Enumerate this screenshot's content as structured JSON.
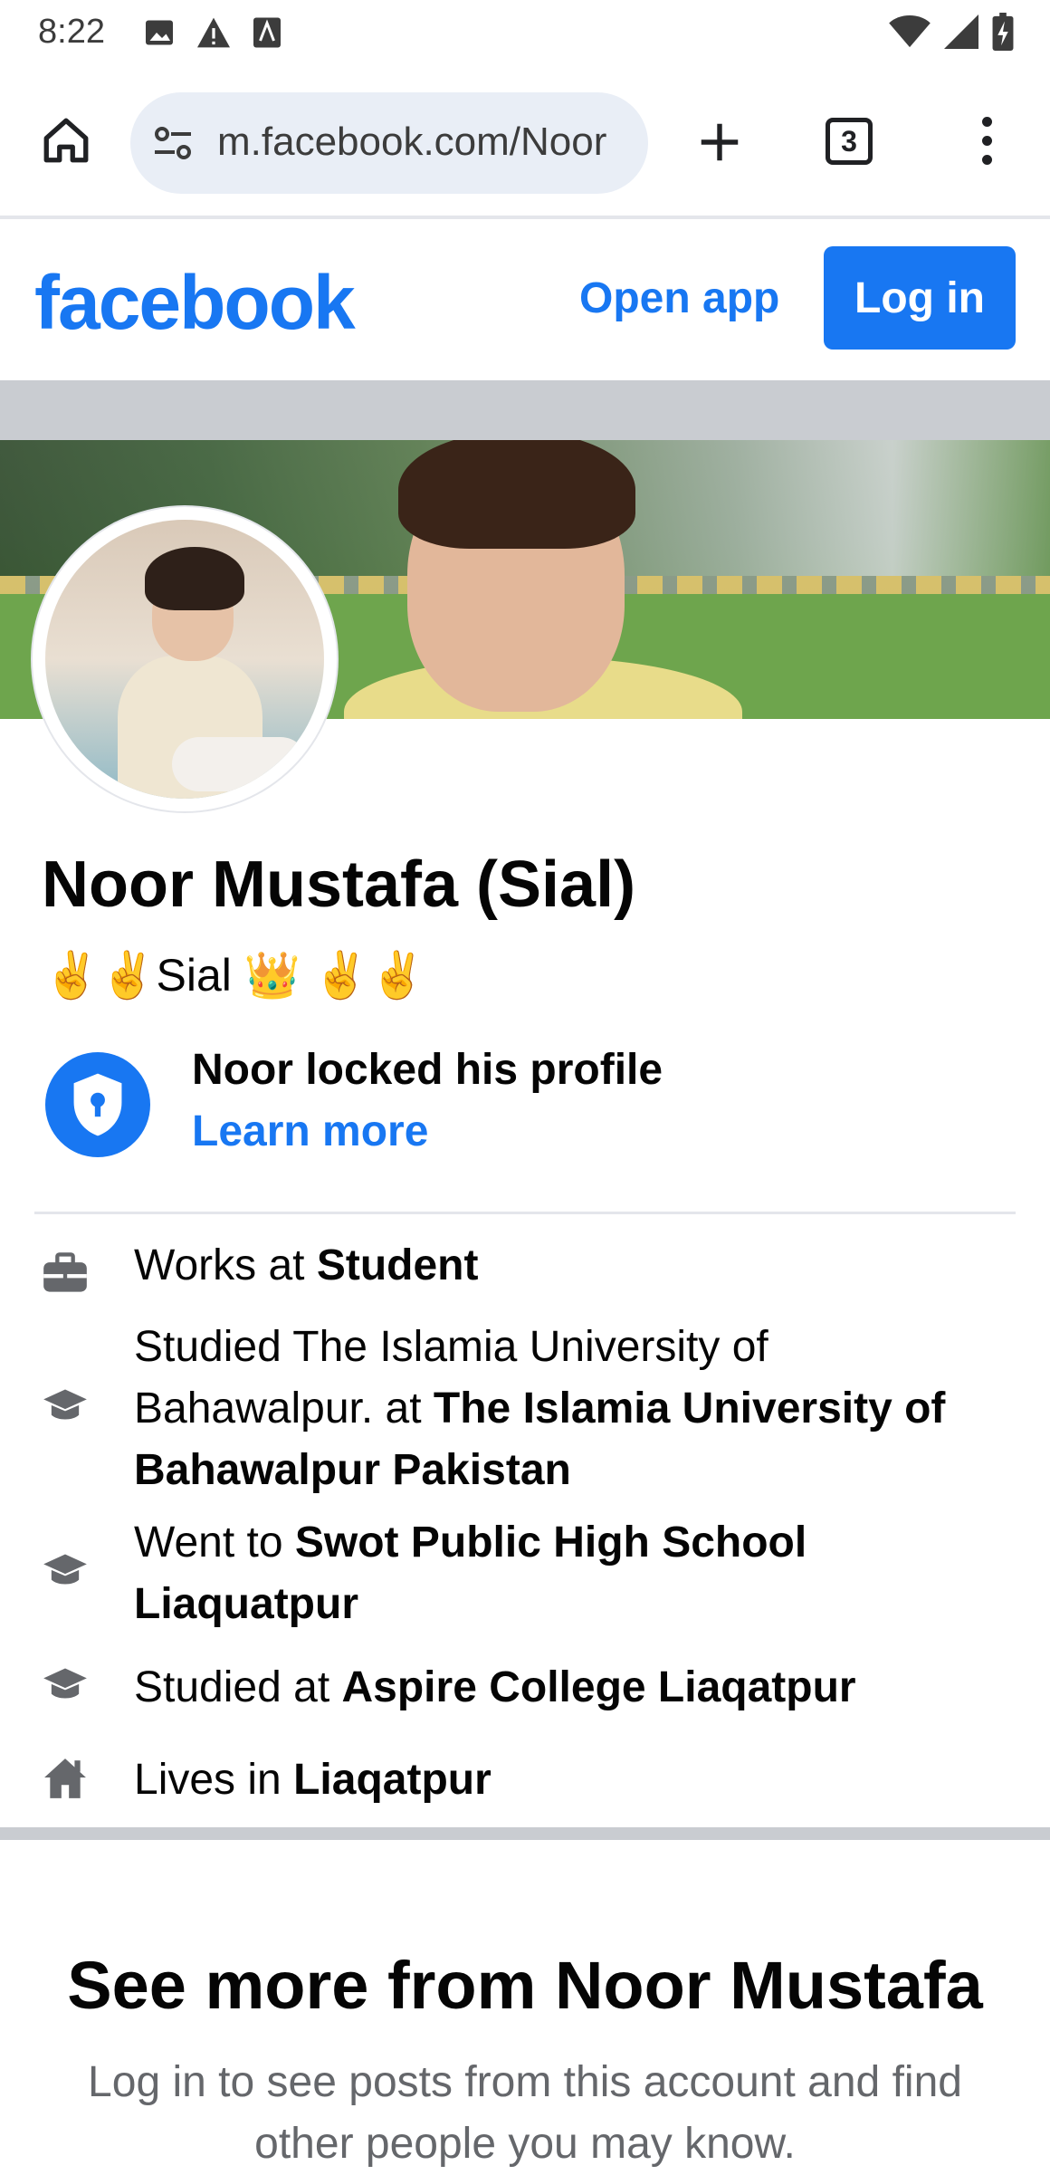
{
  "status_bar": {
    "time": "8:22"
  },
  "browser": {
    "url": "m.facebook.com/Noor",
    "tab_count": "3"
  },
  "header": {
    "logo": "facebook",
    "open_app": "Open app",
    "login": "Log in"
  },
  "profile": {
    "name": "Noor Mustafa (Sial)",
    "bio": "✌️✌️Sial 👑 ✌️✌️",
    "locked_title": "Noor locked his profile",
    "learn_more": "Learn more"
  },
  "intro": {
    "work": {
      "prefix": "Works at ",
      "value": "Student",
      "icon": "briefcase-icon"
    },
    "university": {
      "prefix": "Studied The Islamia University of Bahawalpur. at ",
      "value": "The Islamia University of Bahawalpur Pakistan",
      "icon": "graduation-cap-icon"
    },
    "high_school": {
      "prefix": "Went to ",
      "value": "Swot Public High School Liaquatpur",
      "icon": "graduation-cap-icon"
    },
    "college": {
      "prefix": "Studied at ",
      "value": "Aspire College Liaqatpur",
      "icon": "graduation-cap-icon"
    },
    "lives": {
      "prefix": "Lives in ",
      "value": "Liaqatpur",
      "icon": "home-icon"
    }
  },
  "see_more": {
    "title": "See more from Noor Mustafa",
    "subtitle": "Log in to see posts from this account and find other people you may know."
  },
  "colors": {
    "brand_blue": "#1877f2",
    "divider": "#c9ccd1",
    "secondary_text": "#65676b"
  }
}
